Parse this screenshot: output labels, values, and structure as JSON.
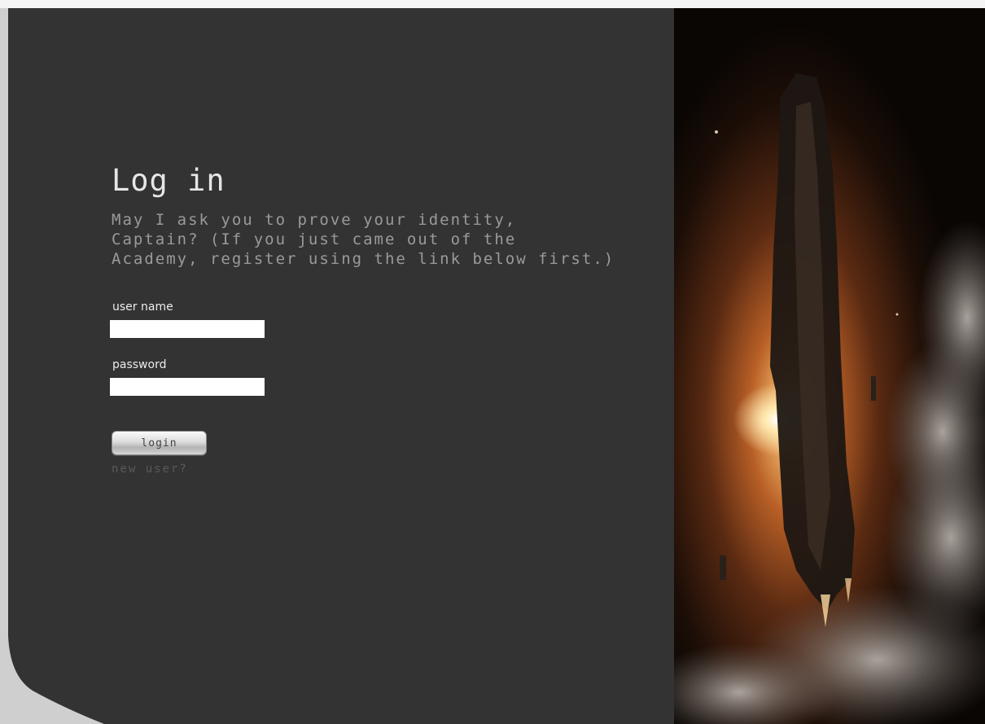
{
  "login": {
    "title": "Log in",
    "intro": "May I ask you to prove your identity,\nCaptain? (If you just came out of the\nAcademy, register using the link below first.)",
    "username_label": "user name",
    "username_value": "",
    "password_label": "password",
    "password_value": "",
    "login_button": "login",
    "new_user_link": "new user?"
  },
  "colors": {
    "panel": "#333333",
    "title": "#e6e6e6",
    "intro": "#9a9a9a",
    "link": "#5a5a5a"
  },
  "hero": {
    "icon": "spaceship-nebula-image"
  }
}
